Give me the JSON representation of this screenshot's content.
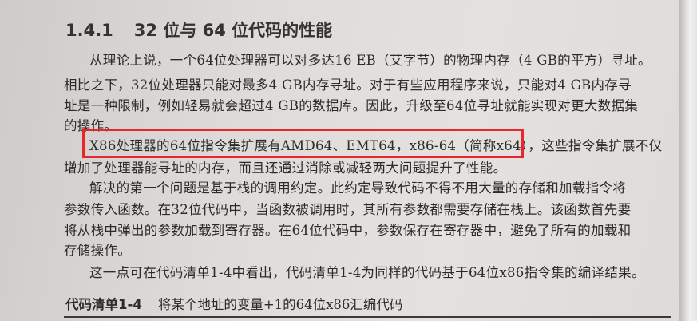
{
  "section": {
    "number": "1.4.1",
    "title": "32 位与 64 位代码的性能"
  },
  "paragraphs": [
    {
      "lines": [
        "从理论上说，一个64位处理器可以对多达16 EB（艾字节）的物理内存（4 GB的平方）寻址。",
        "相比之下，32位处理器只能对最多4 GB内存寻址。对于有些应用程序来说，只能对4 GB内存寻",
        "址是一种限制，例如轻易就会超过4 GB的数据库。因此，升级至64位寻址就能实现对更大数据集",
        "的操作。"
      ]
    },
    {
      "lines": [
        "X86处理器的64位指令集扩展有AMD64、EMT64，x86-64（简称x64），这些指令集扩展不仅",
        "增加了处理器能寻址的内存，而且还通过消除或减轻两大问题提升了性能。"
      ]
    },
    {
      "lines": [
        "解决的第一个问题是基于栈的调用约定。此约定导致代码不得不用大量的存储和加载指令将",
        "参数传入函数。在32位代码中，当函数被调用时，其所有参数都需要存储在栈上。该函数首先要",
        "将从栈中弹出的参数加载到寄存器。在64位代码中，参数保存在寄存器中，避免了所有的加载和",
        "存储操作。"
      ]
    },
    {
      "lines": [
        "这一点可在代码清单1-4中看出，代码清单1-4为同样的代码基于64位x86指令集的编译结果。"
      ]
    }
  ],
  "listing": {
    "label": "代码清单1-4",
    "caption": "将某个地址的变量+1的64位x86汇编代码"
  },
  "highlight_color": "#e8262b"
}
